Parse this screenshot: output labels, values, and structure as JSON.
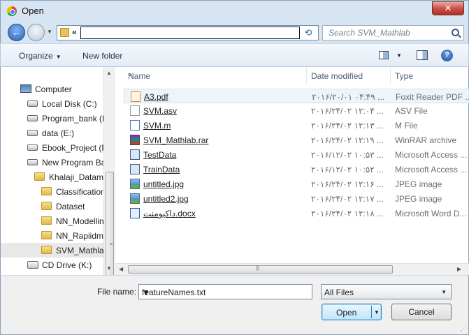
{
  "window": {
    "title": "Open",
    "close_glyph": "✕"
  },
  "nav": {
    "back_glyph": "←",
    "forward_glyph": "→",
    "history_glyph": "▼",
    "path_prefix": "«",
    "refresh_glyph": "⟲",
    "search_placeholder": "Search SVM_Mathlab"
  },
  "toolbar": {
    "organize_label": "Organize",
    "organize_caret": "▼",
    "new_folder_label": "New folder",
    "views_caret": "▼",
    "help_glyph": "?"
  },
  "sidebar": {
    "items": [
      {
        "label": "Computer",
        "icon": "computer-icon"
      },
      {
        "label": "Local Disk (C:)",
        "icon": "windows-disk-icon"
      },
      {
        "label": "Program_bank (D",
        "icon": "disk-icon"
      },
      {
        "label": "data (E:)",
        "icon": "disk-icon"
      },
      {
        "label": "Ebook_Project (F",
        "icon": "disk-icon"
      },
      {
        "label": "New Program Ba",
        "icon": "disk-icon"
      },
      {
        "label": "Khalaji_Datami",
        "icon": "folder-icon"
      },
      {
        "label": "Classification",
        "icon": "folder-icon"
      },
      {
        "label": "Dataset",
        "icon": "folder-icon"
      },
      {
        "label": "NN_Modellin",
        "icon": "folder-icon"
      },
      {
        "label": "NN_Rapiidm",
        "icon": "folder-icon"
      },
      {
        "label": "SVM_Mathlab",
        "icon": "folder-icon"
      },
      {
        "label": "CD Drive (K:)",
        "icon": "cd-drive-icon"
      }
    ]
  },
  "columns": {
    "name": "Name",
    "date": "Date modified",
    "type": "Type",
    "sort_glyph": "▲"
  },
  "files": [
    {
      "name": "A3.pdf",
      "date": "۲۰۱۶/۲۰/۰۱ ۰۴:۴۹ ...",
      "type": "Foxit Reader PDF ...",
      "icon": "pdf-icon"
    },
    {
      "name": "SVM.asv",
      "date": "۲۰۱۶/۲۴/۰۲ ۱۲:۰۴ ...",
      "type": "ASV File",
      "icon": "generic-file-icon"
    },
    {
      "name": "SVM.m",
      "date": "۲۰۱۶/۲۴/۰۲ ۱۲:۱۳ ...",
      "type": "M File",
      "icon": "m-file-icon"
    },
    {
      "name": "SVM_Mathlab.rar",
      "date": "۲۰۱۶/۲۴/۰۲ ۱۲:۱۹ ...",
      "type": "WinRAR archive",
      "icon": "rar-icon"
    },
    {
      "name": "TestData",
      "date": "۲۰۱۶/۱۲/۰۲ ۱۰:۵۳ ...",
      "type": "Microsoft Access ...",
      "icon": "access-icon"
    },
    {
      "name": "TrainData",
      "date": "۲۰۱۶/۱۲/۰۲ ۱۰:۵۲ ...",
      "type": "Microsoft Access ...",
      "icon": "access-icon"
    },
    {
      "name": "untitled.jpg",
      "date": "۲۰۱۶/۲۴/۰۲ ۱۲:۱۶ ...",
      "type": "JPEG image",
      "icon": "jpeg-icon"
    },
    {
      "name": "untitled2.jpg",
      "date": "۲۰۱۶/۲۴/۰۲ ۱۲:۱۷ ...",
      "type": "JPEG image",
      "icon": "jpeg-icon"
    },
    {
      "name": "داکیومنت.docx",
      "date": "۲۰۱۶/۲۴/۰۲ ۱۲:۱۸ ...",
      "type": "Microsoft Word D...",
      "icon": "word-icon"
    }
  ],
  "scroll_glyphs": {
    "up": "▲",
    "down": "▼",
    "left": "◀",
    "right": "▶",
    "v_grip": "≡",
    "h_grip": "|||"
  },
  "bottom": {
    "file_name_label": "File name:",
    "file_name_value": "featureNames.txt",
    "file_name_caret": "▼",
    "filter_value": "All Files",
    "filter_caret": "▼",
    "open_label": "Open",
    "open_caret": "▼",
    "cancel_label": "Cancel",
    "grip_glyph": "⋰"
  }
}
